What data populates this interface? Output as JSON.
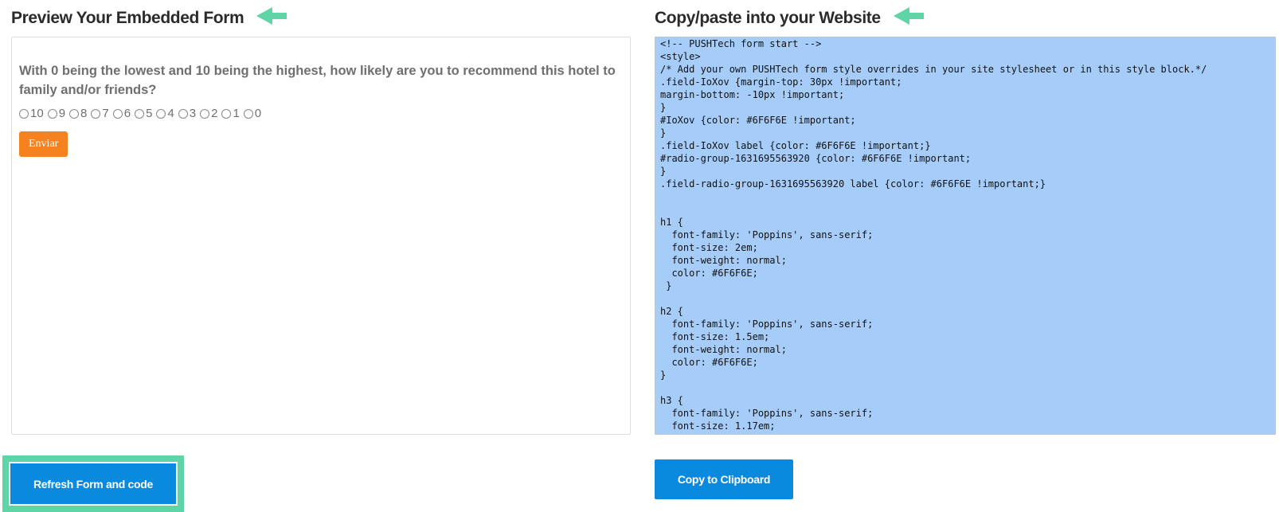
{
  "preview": {
    "title": "Preview Your Embedded Form",
    "question": "With 0 being the lowest and 10 being the highest, how likely are you to recommend this hotel to family and/or friends?",
    "options": [
      "10",
      "9",
      "8",
      "7",
      "6",
      "5",
      "4",
      "3",
      "2",
      "1",
      "0"
    ],
    "submit_label": "Enviar",
    "submit_color": "#F5821F",
    "text_color": "#6F6F6E"
  },
  "code": {
    "title": "Copy/paste into your Website",
    "content": "<!-- PUSHTech form start -->\n<style>\n/* Add your own PUSHTech form style overrides in your site stylesheet or in this style block.*/\n.field-IoXov {margin-top: 30px !important;\nmargin-bottom: -10px !important;\n}\n#IoXov {color: #6F6F6E !important;\n}\n.field-IoXov label {color: #6F6F6E !important;}\n#radio-group-1631695563920 {color: #6F6F6E !important;\n}\n.field-radio-group-1631695563920 label {color: #6F6F6E !important;}\n\n\nh1 {\n  font-family: 'Poppins', sans-serif;\n  font-size: 2em;\n  font-weight: normal;\n  color: #6F6F6E;\n }\n\nh2 {\n  font-family: 'Poppins', sans-serif;\n  font-size: 1.5em;\n  font-weight: normal;\n  color: #6F6F6E;\n}\n\nh3 {\n  font-family: 'Poppins', sans-serif;\n  font-size: 1.17em;",
    "selection_color": "#A6CDFA"
  },
  "actions": {
    "refresh_label": "Refresh Form and code",
    "copy_label": "Copy to Clipboard",
    "button_color": "#0A8ADF",
    "highlight_color": "#5FD4A6"
  },
  "icons": {
    "pointer_arrow": "arrow-left-icon"
  }
}
